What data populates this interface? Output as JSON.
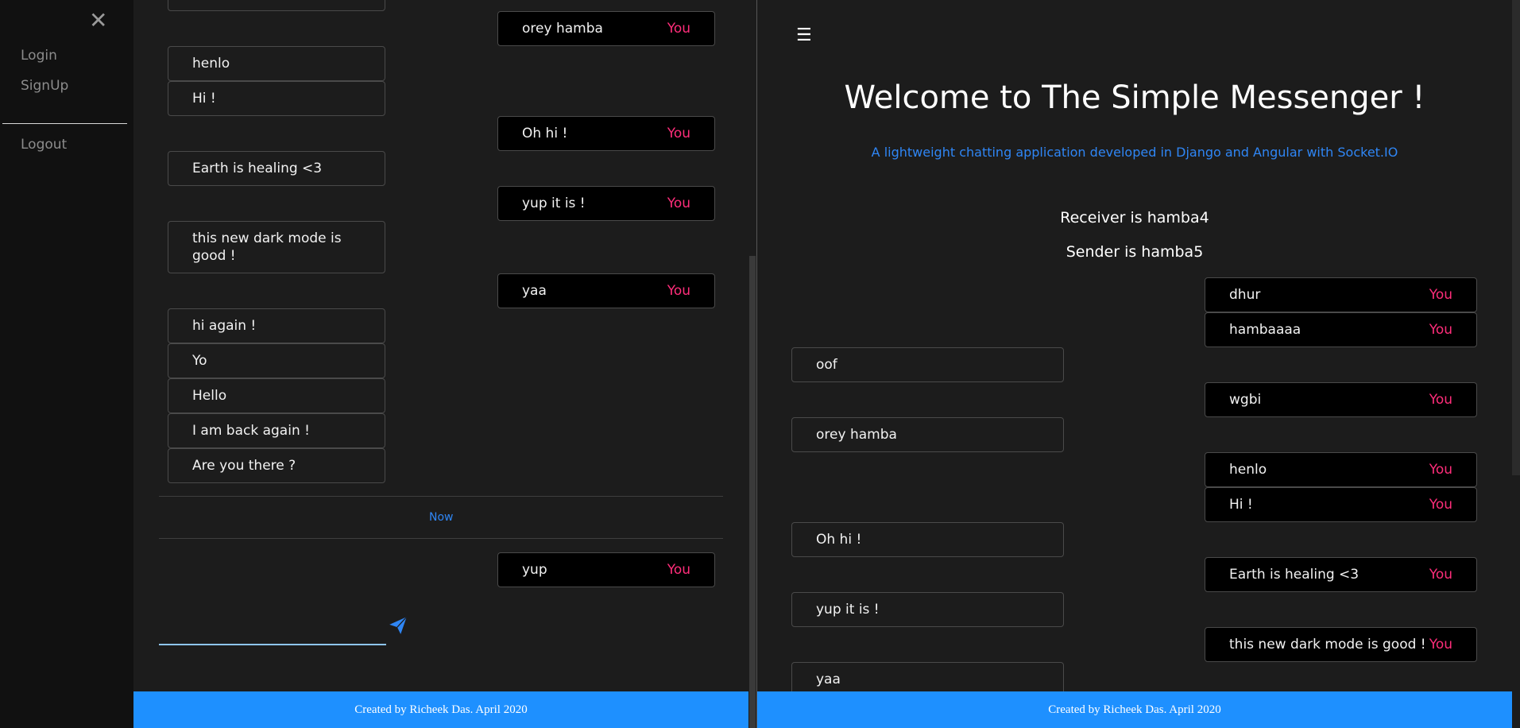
{
  "sidebar": {
    "close_icon": "✕",
    "links": {
      "login": "Login",
      "signup": "SignUp",
      "logout": "Logout"
    }
  },
  "left_chat": {
    "messages": [
      {
        "text": "orey hamba",
        "side": "sent",
        "tag": "You"
      },
      {
        "text": "henlo",
        "side": "recv"
      },
      {
        "text": "Hi !",
        "side": "recv"
      },
      {
        "text": "Oh hi !",
        "side": "sent",
        "tag": "You"
      },
      {
        "text": "Earth is healing <3",
        "side": "recv"
      },
      {
        "text": "yup it is !",
        "side": "sent",
        "tag": "You"
      },
      {
        "text": "this new dark mode is good !",
        "side": "recv"
      },
      {
        "text": "yaa",
        "side": "sent",
        "tag": "You"
      },
      {
        "text": "hi again !",
        "side": "recv"
      },
      {
        "text": "Yo",
        "side": "recv"
      },
      {
        "text": "Hello",
        "side": "recv"
      },
      {
        "text": "I am back again !",
        "side": "recv"
      },
      {
        "text": "Are you there ?",
        "side": "recv"
      }
    ],
    "separator_label": "Now",
    "latest": {
      "text": "yup",
      "tag": "You"
    },
    "input_value": "",
    "send_icon": "paper-plane-icon"
  },
  "right_chat": {
    "menu_icon": "☰",
    "title": "Welcome to The Simple Messenger !",
    "subtitle": "A lightweight chatting application developed in Django and Angular with Socket.IO",
    "receiver_line": "Receiver is hamba4",
    "sender_line": "Sender is hamba5",
    "messages": [
      {
        "text": "dhur",
        "side": "sent",
        "tag": "You"
      },
      {
        "text": "hambaaaa",
        "side": "sent",
        "tag": "You"
      },
      {
        "text": "oof",
        "side": "recv"
      },
      {
        "text": "wgbi",
        "side": "sent",
        "tag": "You"
      },
      {
        "text": "orey hamba",
        "side": "recv"
      },
      {
        "text": "henlo",
        "side": "sent",
        "tag": "You"
      },
      {
        "text": "Hi !",
        "side": "sent",
        "tag": "You"
      },
      {
        "text": "Oh hi !",
        "side": "recv"
      },
      {
        "text": "Earth is healing <3",
        "side": "sent",
        "tag": "You"
      },
      {
        "text": "yup it is !",
        "side": "recv"
      },
      {
        "text": "this new dark mode is good !",
        "side": "sent",
        "tag": "You"
      },
      {
        "text": "yaa",
        "side": "recv"
      }
    ]
  },
  "footer": {
    "text": "Created by Richeek Das. April 2020"
  },
  "colors": {
    "accent": "#1e90ff",
    "you_tag": "#ff2d7a",
    "link_blue": "#2f86f5",
    "bg": "#1c1c1c",
    "sidebar_bg": "#111111"
  }
}
